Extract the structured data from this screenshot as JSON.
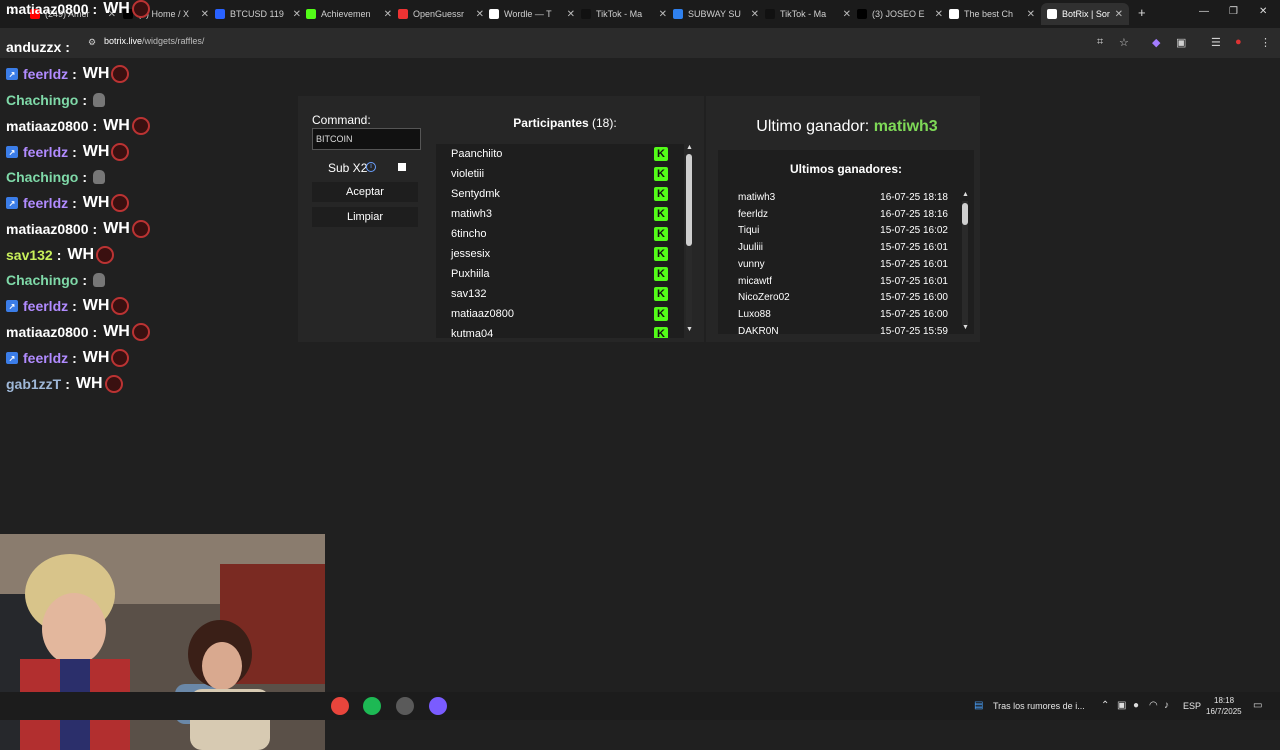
{
  "browser": {
    "tabs": [
      {
        "title": "(249) Amer",
        "fav": "#ff0000"
      },
      {
        "title": "(3) Home / X",
        "fav": "#000000"
      },
      {
        "title": "BTCUSD 119",
        "fav": "#2962ff"
      },
      {
        "title": "Achievemen",
        "fav": "#53fc18"
      },
      {
        "title": "OpenGuessr",
        "fav": "#e33"
      },
      {
        "title": "Wordle — T",
        "fav": "#fff"
      },
      {
        "title": "TikTok - Ma",
        "fav": "#111"
      },
      {
        "title": "SUBWAY SU",
        "fav": "#2f80ed"
      },
      {
        "title": "TikTok - Ma",
        "fav": "#111"
      },
      {
        "title": "(3) JOSEO E",
        "fav": "#000000"
      },
      {
        "title": "The best Ch",
        "fav": "#fff"
      },
      {
        "title": "BotRix | Sor",
        "fav": "#fff"
      }
    ],
    "url_host": "botrix.live",
    "url_path": "/widgets/raffles/"
  },
  "chat": {
    "messages": [
      {
        "user": "matiaaz0800",
        "color": "#ffffff",
        "text": "WH",
        "badge": false,
        "emote": "ring"
      },
      {
        "user": "anduzzx",
        "color": "#ffffff",
        "text": "",
        "badge": false,
        "emote": "none"
      },
      {
        "user": "feerldz",
        "color": "#b18bff",
        "text": "WH",
        "badge": true,
        "emote": "ring"
      },
      {
        "user": "Chachingo",
        "color": "#7fd9a8",
        "text": "",
        "badge": false,
        "emote": "skull"
      },
      {
        "user": "matiaaz0800",
        "color": "#ffffff",
        "text": "WH",
        "badge": false,
        "emote": "ring"
      },
      {
        "user": "feerldz",
        "color": "#b18bff",
        "text": "WH",
        "badge": true,
        "emote": "ring"
      },
      {
        "user": "Chachingo",
        "color": "#7fd9a8",
        "text": "",
        "badge": false,
        "emote": "skull"
      },
      {
        "user": "feerldz",
        "color": "#b18bff",
        "text": "WH",
        "badge": true,
        "emote": "ring"
      },
      {
        "user": "matiaaz0800",
        "color": "#ffffff",
        "text": "WH",
        "badge": false,
        "emote": "ring"
      },
      {
        "user": "sav132",
        "color": "#c8f05a",
        "text": "WH",
        "badge": false,
        "emote": "ring"
      },
      {
        "user": "Chachingo",
        "color": "#7fd9a8",
        "text": "",
        "badge": false,
        "emote": "skull"
      },
      {
        "user": "feerldz",
        "color": "#b18bff",
        "text": "WH",
        "badge": true,
        "emote": "ring"
      },
      {
        "user": "matiaaz0800",
        "color": "#ffffff",
        "text": "WH",
        "badge": false,
        "emote": "ring"
      },
      {
        "user": "feerldz",
        "color": "#b18bff",
        "text": "WH",
        "badge": true,
        "emote": "ring"
      },
      {
        "user": "gab1zzT",
        "color": "#9fb8d8",
        "text": "WH",
        "badge": false,
        "emote": "ring"
      }
    ]
  },
  "raffle": {
    "command_label": "Command:",
    "command_value": "BITCOIN",
    "sub_label": "Sub X2",
    "accept_label": "Aceptar",
    "clear_label": "Limpiar",
    "participants_label": "Participantes",
    "participants_count": "(18):",
    "participants": [
      "Paanchiito",
      "violetiii",
      "Sentydmk",
      "matiwh3",
      "6tincho",
      "jessesix",
      "Puxhiila",
      "sav132",
      "matiaaz0800",
      "kutma04"
    ],
    "last_winner_label": "Ultimo ganador:",
    "last_winner_name": "matiwh3",
    "winners_title": "Ultimos ganadores:",
    "winners": [
      {
        "name": "matiwh3",
        "date": "16-07-25 18:18"
      },
      {
        "name": "feerldz",
        "date": "16-07-25 18:16"
      },
      {
        "name": "Tiqui",
        "date": "15-07-25 16:02"
      },
      {
        "name": "Juuliii",
        "date": "15-07-25 16:01"
      },
      {
        "name": "vunny",
        "date": "15-07-25 16:01"
      },
      {
        "name": "micawtf",
        "date": "15-07-25 16:01"
      },
      {
        "name": "NicoZero02",
        "date": "15-07-25 16:00"
      },
      {
        "name": "Luxo88",
        "date": "15-07-25 16:00"
      },
      {
        "name": "DAKR0N",
        "date": "15-07-25 15:59"
      }
    ],
    "kick_color": "#53fc18"
  },
  "taskbar": {
    "news": "Tras los rumores de i...",
    "lang": "ESP",
    "time": "18:18",
    "date": "16/7/2025"
  }
}
